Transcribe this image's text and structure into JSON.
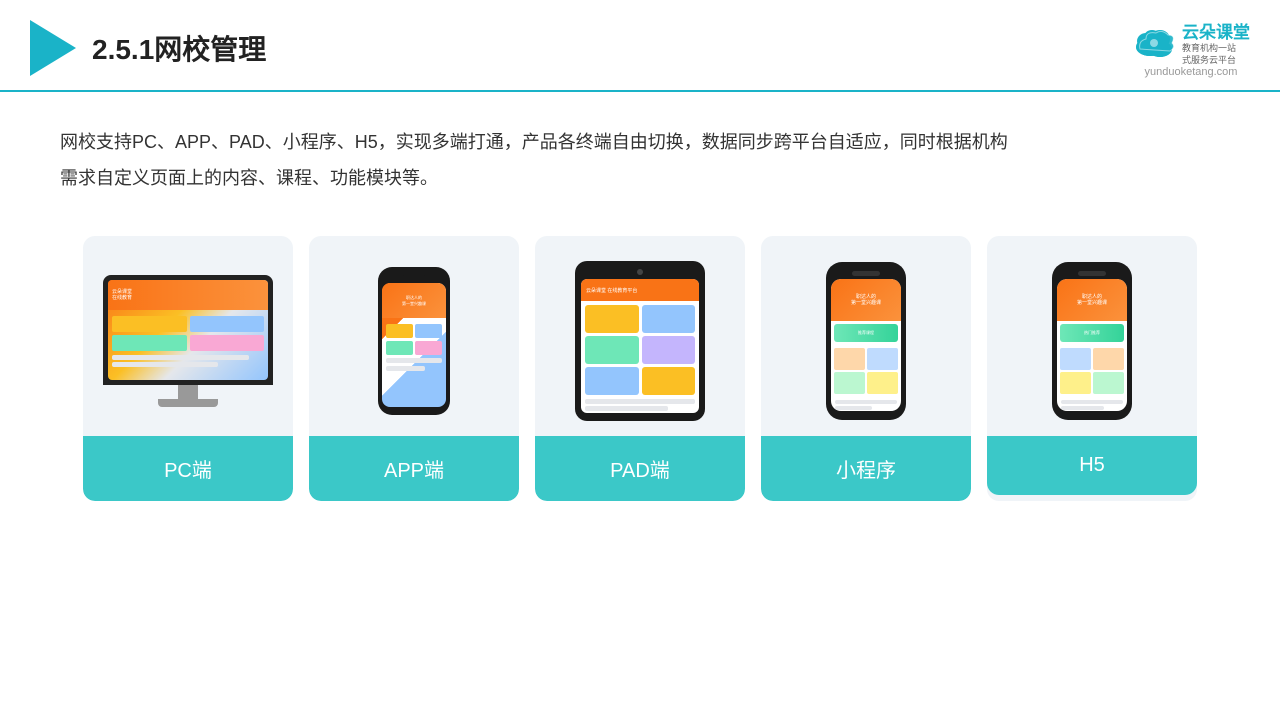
{
  "header": {
    "title": "2.5.1网校管理",
    "brand": {
      "name": "云朵课堂",
      "tagline": "教育机构一站\n式服务云平台",
      "url": "yunduoketang.com"
    }
  },
  "description": {
    "text": "网校支持PC、APP、PAD、小程序、H5，实现多端打通，产品各终端自由切换，数据同步跨平台自适应，同时根据机构需求自定义页面上的内容、课程、功能模块等。"
  },
  "cards": [
    {
      "id": "pc",
      "label": "PC端"
    },
    {
      "id": "app",
      "label": "APP端"
    },
    {
      "id": "pad",
      "label": "PAD端"
    },
    {
      "id": "miniprogram",
      "label": "小程序"
    },
    {
      "id": "h5",
      "label": "H5"
    }
  ],
  "colors": {
    "accent": "#1ab3c8",
    "card_bg": "#f0f4f8",
    "label_bg": "#3bc8c8"
  }
}
